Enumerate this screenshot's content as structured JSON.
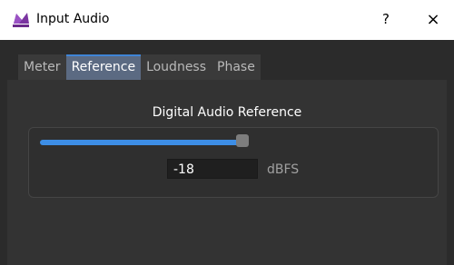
{
  "window": {
    "title": "Input Audio",
    "help_label": "?",
    "close_label": "×"
  },
  "tabs": [
    {
      "label": "Meter",
      "active": false
    },
    {
      "label": "Reference",
      "active": true
    },
    {
      "label": "Loudness",
      "active": false
    },
    {
      "label": "Phase",
      "active": false
    }
  ],
  "reference": {
    "section_title": "Digital Audio Reference",
    "value": "-18",
    "unit": "dBFS"
  },
  "colors": {
    "titlebar_bg": "#ffffff",
    "content_bg": "#2b2b2b",
    "tab_active_bg": "#5b6a82",
    "slider_fill": "#3d8ee6"
  }
}
